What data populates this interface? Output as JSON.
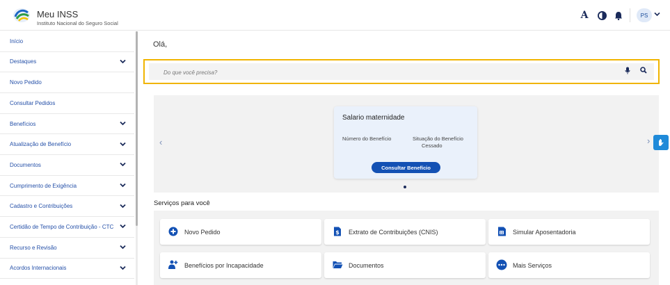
{
  "header": {
    "app_title": "Meu INSS",
    "app_subtitle": "Instituto Nacional do Seguro Social",
    "font_icon_glyph": "A",
    "avatar_initials": "PS",
    "icons": [
      "font-size-icon",
      "contrast-icon",
      "bell-icon",
      "chevron-down-icon"
    ]
  },
  "sidebar": {
    "items": [
      {
        "label": "Início",
        "has_chevron": false
      },
      {
        "label": "Destaques",
        "has_chevron": true
      },
      {
        "label": "Novo Pedido",
        "has_chevron": false
      },
      {
        "label": "Consultar Pedidos",
        "has_chevron": false
      },
      {
        "label": "Benefícios",
        "has_chevron": true
      },
      {
        "label": "Atualização de Benefício",
        "has_chevron": true
      },
      {
        "label": "Documentos",
        "has_chevron": true
      },
      {
        "label": "Cumprimento de Exigência",
        "has_chevron": true
      },
      {
        "label": "Cadastro e Contribuições",
        "has_chevron": true
      },
      {
        "label": "Certidão de Tempo de Contribuição - CTC",
        "has_chevron": true
      },
      {
        "label": "Recurso e Revisão",
        "has_chevron": true
      },
      {
        "label": "Acordos Internacionais",
        "has_chevron": true
      }
    ]
  },
  "main": {
    "greeting": "Olá,",
    "search": {
      "placeholder": "Do que você precisa?"
    },
    "carousel": {
      "card_title": "Salario maternidade",
      "label_1": "Número do Benefício",
      "label_2": "Situação do Benefício",
      "value_2": "Cessado",
      "button_label": "Consultar Benefício"
    },
    "services_title": "Serviços para você",
    "services": [
      {
        "label": "Novo Pedido",
        "icon": "plus-circle-icon"
      },
      {
        "label": "Extrato de Contribuições (CNIS)",
        "icon": "document-dollar-icon"
      },
      {
        "label": "Simular Aposentadoria",
        "icon": "calculator-document-icon"
      },
      {
        "label": "Benefícios por Incapacidade",
        "icon": "person-medical-icon"
      },
      {
        "label": "Documentos",
        "icon": "folder-open-icon"
      },
      {
        "label": "Mais Serviços",
        "icon": "more-dots-icon"
      }
    ]
  },
  "colors": {
    "brand_blue": "#1351b4",
    "link_blue": "#2550a8",
    "focus_yellow": "#f0b400",
    "accessibility_blue": "#1f8ad9"
  }
}
